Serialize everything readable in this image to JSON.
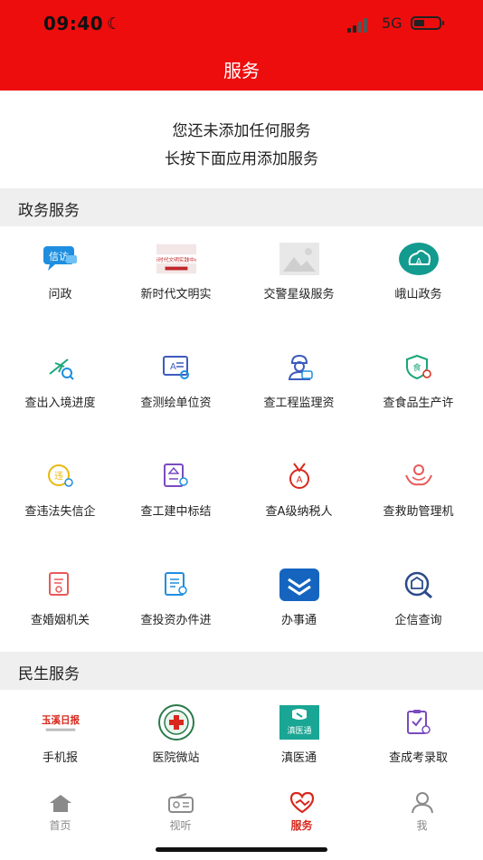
{
  "status_bar": {
    "time": "09:40",
    "network": "5G"
  },
  "header": {
    "title": "服务"
  },
  "empty_hint": {
    "line1": "您还未添加任何服务",
    "line2": "长按下面应用添加服务"
  },
  "sections": {
    "government": {
      "title": "政务服务",
      "items": [
        {
          "label": "问政",
          "icon": "wenzheng-icon"
        },
        {
          "label": "新时代文明实",
          "icon": "civilization-practice-icon",
          "banner": "新时代文明实践中心"
        },
        {
          "label": "交警星级服务",
          "icon": "image-placeholder-icon"
        },
        {
          "label": "峨山政务",
          "icon": "eshan-gov-icon"
        },
        {
          "label": "查出入境进度",
          "icon": "plane-icon"
        },
        {
          "label": "查测绘单位资",
          "icon": "surveying-icon"
        },
        {
          "label": "查工程监理资",
          "icon": "engineer-icon"
        },
        {
          "label": "查食品生产许",
          "icon": "food-shield-icon"
        },
        {
          "label": "查违法失信企",
          "icon": "violation-icon"
        },
        {
          "label": "查工建中标结",
          "icon": "construction-bid-icon"
        },
        {
          "label": "查A级纳税人",
          "icon": "tax-medal-icon"
        },
        {
          "label": "查救助管理机",
          "icon": "aid-hands-icon"
        },
        {
          "label": "查婚姻机关",
          "icon": "marriage-icon"
        },
        {
          "label": "查投资办件进",
          "icon": "investment-doc-icon"
        },
        {
          "label": "办事通",
          "icon": "banshitong-icon"
        },
        {
          "label": "企信查询",
          "icon": "enterprise-search-icon"
        }
      ]
    },
    "livelihood": {
      "title": "民生服务",
      "items": [
        {
          "label": "手机报",
          "icon": "newspaper-logo-icon",
          "logo_text": "玉溪日报"
        },
        {
          "label": "医院微站",
          "icon": "hospital-logo-icon"
        },
        {
          "label": "滇医通",
          "icon": "dianyitong-icon",
          "logo_text": "滇医通"
        },
        {
          "label": "查成考录取",
          "icon": "exam-clipboard-icon"
        }
      ]
    }
  },
  "tabbar": [
    {
      "label": "首页",
      "icon": "home-icon",
      "active": false
    },
    {
      "label": "视听",
      "icon": "radio-icon",
      "active": false
    },
    {
      "label": "服务",
      "icon": "heart-service-icon",
      "active": true
    },
    {
      "label": "我",
      "icon": "user-icon",
      "active": false
    }
  ],
  "colors": {
    "brand_red": "#ee0d0d",
    "active_tab": "#d8281d"
  }
}
